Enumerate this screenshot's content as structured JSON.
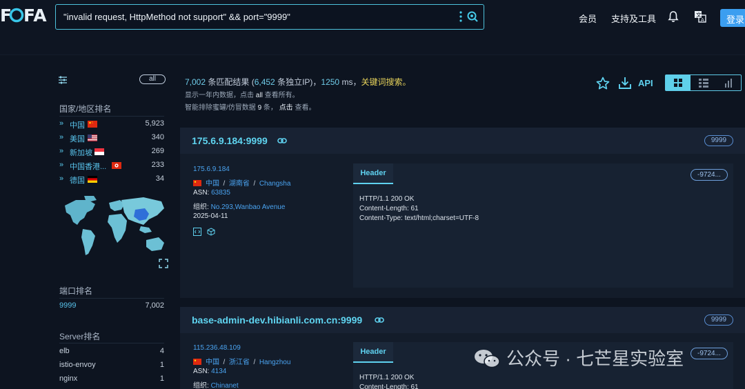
{
  "app": {
    "logo": "FOFA",
    "search_query": "\"invalid request, HttpMethod not support\" && port=\"9999\"",
    "nav": [
      "会员",
      "支持及工具"
    ],
    "login_label": "登录"
  },
  "sidebar": {
    "all_label": "all",
    "country_title": "国家/地区排名",
    "countries": [
      {
        "name": "中国",
        "count": "5,923",
        "flag": "cn"
      },
      {
        "name": "美国",
        "count": "340",
        "flag": "us"
      },
      {
        "name": "新加坡",
        "count": "269",
        "flag": "sg"
      },
      {
        "name": "中国香港...",
        "count": "233",
        "flag": "hk"
      },
      {
        "name": "德国",
        "count": "34",
        "flag": "de"
      }
    ],
    "port_title": "端口排名",
    "ports": [
      {
        "name": "9999",
        "count": "7,002"
      }
    ],
    "server_title": "Server排名",
    "servers": [
      {
        "name": "elb",
        "count": "4"
      },
      {
        "name": "istio-envoy",
        "count": "1"
      },
      {
        "name": "nginx",
        "count": "1"
      }
    ]
  },
  "summary": {
    "total": "7,002",
    "total_suffix": " 条匹配结果 (",
    "unique_ip": "6,452",
    "unique_suffix": " 条独立IP)，",
    "ms": "1250",
    "ms_suffix": " ms，",
    "keyword": "关键词搜索。",
    "line2_a": "显示一年内数据，点击 ",
    "line2_b": "all",
    "line2_c": " 查看所有。",
    "line3_a": "智能排除蜜罐/仿冒数据 ",
    "line3_b": "9",
    "line3_c": " 条， ",
    "line3_d": "点击",
    "line3_e": " 查看。",
    "api_label": "API"
  },
  "results": [
    {
      "title": "175.6.9.184:9999",
      "port": "9999",
      "ip": "175.6.9.184",
      "country": "中国",
      "region": "湖南省",
      "city": "Changsha",
      "asn_label": "ASN: ",
      "asn": "63835",
      "org_label": "组织: ",
      "org": "No.293,Wanbao Avenue",
      "date": "2025-04-11",
      "header_tab": "Header",
      "hash": "-9724...",
      "header_lines": [
        "HTTP/1.1 200 OK",
        "Content-Length: 61",
        "Content-Type: text/html;charset=UTF-8"
      ]
    },
    {
      "title": "base-admin-dev.hibianli.com.cn:9999",
      "port": "9999",
      "ip": "115.236.48.109",
      "country": "中国",
      "region": "浙江省",
      "city": "Hangzhou",
      "asn_label": "ASN: ",
      "asn": "4134",
      "org_label": "组织: ",
      "org": "Chinanet",
      "header_tab": "Header",
      "hash": "-9724...",
      "header_lines": [
        "HTTP/1.1 200 OK",
        "Content-Length: 61"
      ]
    }
  ],
  "watermark": "公众号 · 七芒星实验室",
  "colors": {
    "accent": "#5fd2f0",
    "link": "#4aa3f0",
    "keyword": "#e7d35b",
    "bg": "#0d1420"
  }
}
